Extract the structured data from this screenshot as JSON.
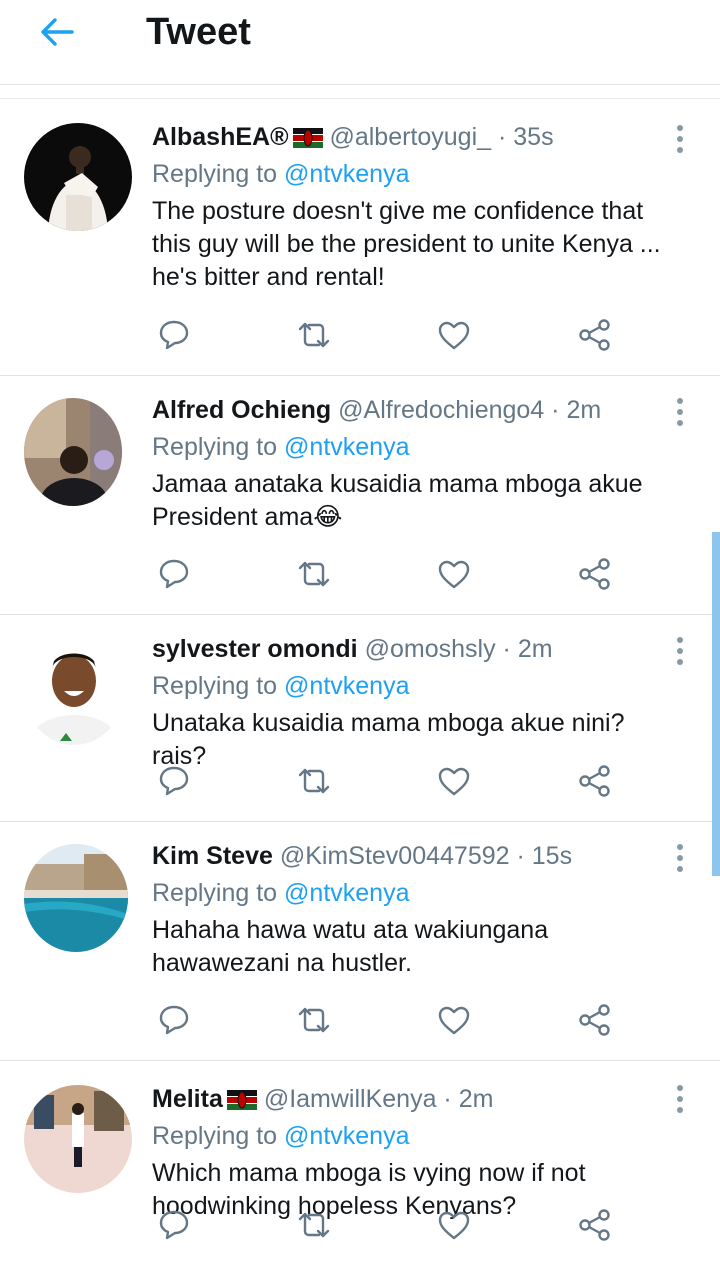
{
  "header": {
    "title": "Tweet"
  },
  "tweets": [
    {
      "name": "AlbashEA®",
      "handle": "@albertoyugi_",
      "time": "35s",
      "replying_label": "Replying to",
      "replying_to": "@ntvkenya",
      "text": "The posture doesn't give me confidence that this guy will be the president to unite Kenya ... he's bitter and rental!"
    },
    {
      "name": "Alfred Ochieng",
      "handle": "@Alfredochiengo4",
      "time": "2m",
      "replying_label": "Replying to",
      "replying_to": "@ntvkenya",
      "text": "Jamaa anataka kusaidia mama mboga akue President ama😂"
    },
    {
      "name": "sylvester omondi",
      "handle": "@omoshsly",
      "time": "2m",
      "replying_label": "Replying to",
      "replying_to": "@ntvkenya",
      "text": "Unataka kusaidia mama mboga akue nini? rais?"
    },
    {
      "name": "Kim Steve",
      "handle": "@KimStev00447592",
      "time": "15s",
      "replying_label": "Replying to",
      "replying_to": "@ntvkenya",
      "text": "Hahaha hawa watu ata wakiungana hawawezani na hustler."
    },
    {
      "name": "Melita",
      "handle": "@IamwillKenya",
      "time": "2m",
      "replying_label": "Replying to",
      "replying_to": "@ntvkenya",
      "text": "Which mama mboga is vying now if not hoodwinking hopeless Kenyans?"
    }
  ],
  "dot_separator": "·",
  "icons": {
    "back": "arrow-left-icon",
    "reply": "speech-bubble-icon",
    "retweet": "retweet-icon",
    "like": "heart-icon",
    "share": "share-icon",
    "more": "vertical-ellipsis-icon",
    "flag": "kenya-flag-icon"
  },
  "colors": {
    "accent": "#1da1f2",
    "text_primary": "#14171a",
    "text_secondary": "#657786",
    "scrollbar": "#8ec5ee"
  }
}
